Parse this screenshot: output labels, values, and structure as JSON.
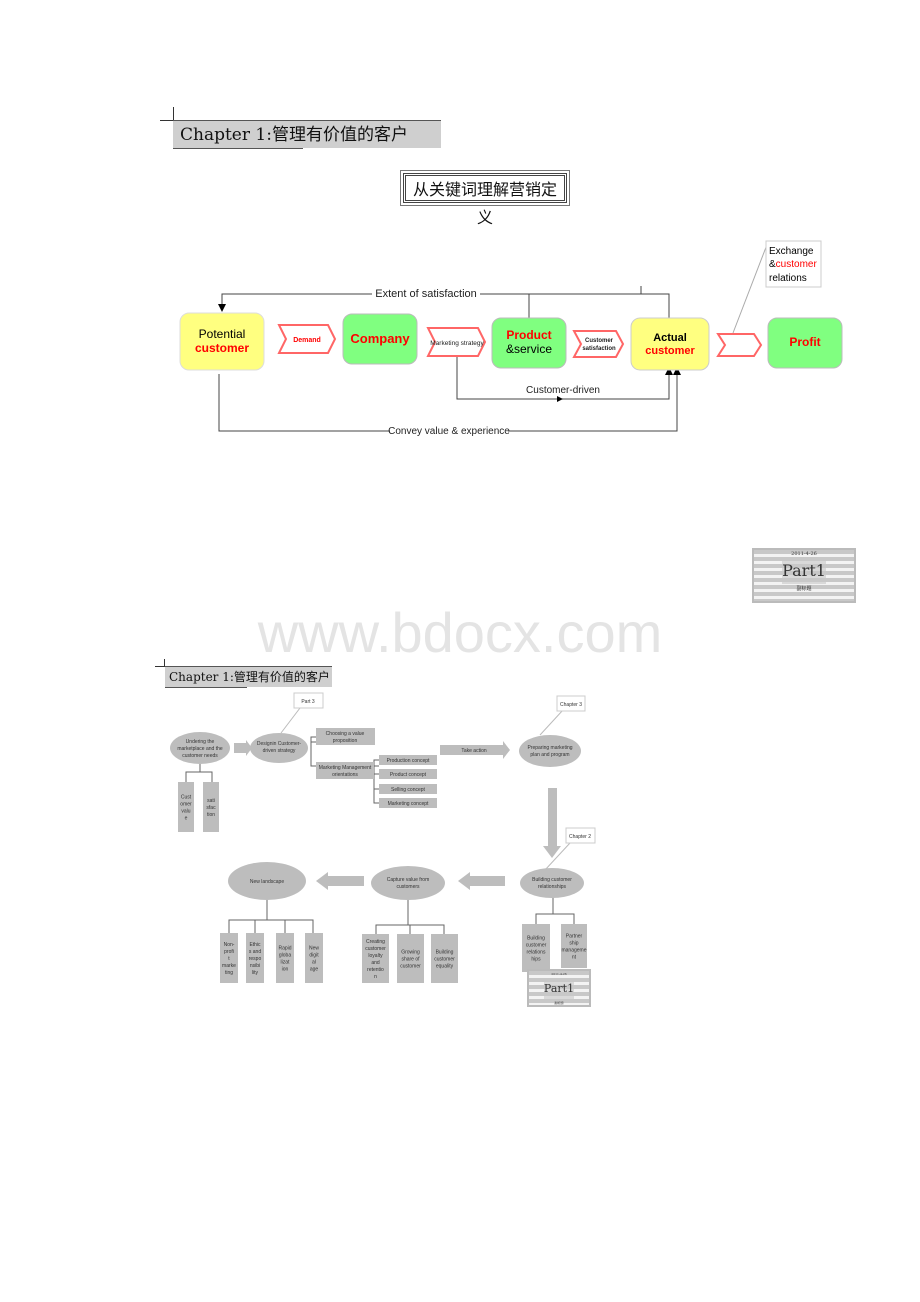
{
  "section1": {
    "heading": "Chapter 1:管理有价值的客户",
    "subtitle": "从关键词理解营销定义",
    "diagram": {
      "nodes": {
        "potential_line1": "Potential",
        "potential_line2": "customer",
        "company": "Company",
        "product_line1": "Product",
        "product_line2": "&service",
        "actual_line1": "Actual",
        "actual_line2": "customer",
        "profit": "Profit"
      },
      "arrows": {
        "demand": "Demand",
        "marketing_strategy": "Marketing strategy",
        "customer_sat_line1": "Customer",
        "customer_sat_line2": "satisfaction"
      },
      "connectors": {
        "extent": "Extent of satisfaction",
        "customer_driven": "Customer-driven",
        "convey": "Convey value & experience"
      },
      "callout": {
        "line1": "Exchange",
        "line2_prefix": "&",
        "line2_red": "customer",
        "line3": "relations"
      },
      "colors": {
        "yellow": "#ffff80",
        "green": "#80ff80",
        "red": "#ff0000",
        "arrow_outline": "#ff6666"
      }
    }
  },
  "stamp": {
    "label": "Part1",
    "date": "2011-4-26",
    "small": "副标题"
  },
  "watermark": "www.bdocx.com",
  "section2": {
    "heading": "Chapter 1:管理有价值的客户",
    "nodes": {
      "undering": [
        "Undering the",
        "marketplace and the",
        "customer needs"
      ],
      "designing": [
        "Designin Customer-",
        "driven strategy"
      ],
      "preparing": [
        "Preparing marketing",
        "plan and program"
      ],
      "building_rel": [
        "Building customer",
        "relationships"
      ],
      "capture": [
        "Capture value from",
        "customers"
      ],
      "landscape": [
        "New landscape"
      ]
    },
    "callouts": {
      "part3": "Part 3",
      "chapter3": "Chapter 3",
      "chapter2": "Chapter 2"
    },
    "boxes": {
      "choosing": [
        "Choosing a value",
        "proposition"
      ],
      "mm_orient": [
        "Marketing Management",
        "orientations"
      ],
      "production": "Production concept",
      "product": "Product concept",
      "selling": "Selling concept",
      "marketing": "Marketing concept",
      "cust_value": [
        "Cust",
        "omer",
        "valu",
        "e"
      ],
      "satisfaction": [
        "sati",
        "sfac",
        "tion"
      ],
      "bcr": [
        "Building",
        "customer",
        "relations",
        "hips"
      ],
      "partner": [
        "Partner",
        "ship",
        "manageme",
        "nt"
      ],
      "creating": [
        "Creating",
        "customer",
        "loyalty",
        "and",
        "retentio",
        "n"
      ],
      "growing": [
        "Growing",
        "share of",
        "customer"
      ],
      "equality": [
        "Building",
        "customer",
        "equality"
      ],
      "nonprofit": [
        "Non-",
        "profi",
        "t",
        "marke",
        "ting"
      ],
      "ethics": [
        "Ethic",
        "s and",
        "respo",
        "nsibi",
        "lity"
      ],
      "rapid": [
        "Rapid",
        "globa",
        "lizat",
        "ion"
      ],
      "digital": [
        "New",
        "digit",
        "al",
        "age"
      ]
    },
    "take_action": "Take action"
  }
}
